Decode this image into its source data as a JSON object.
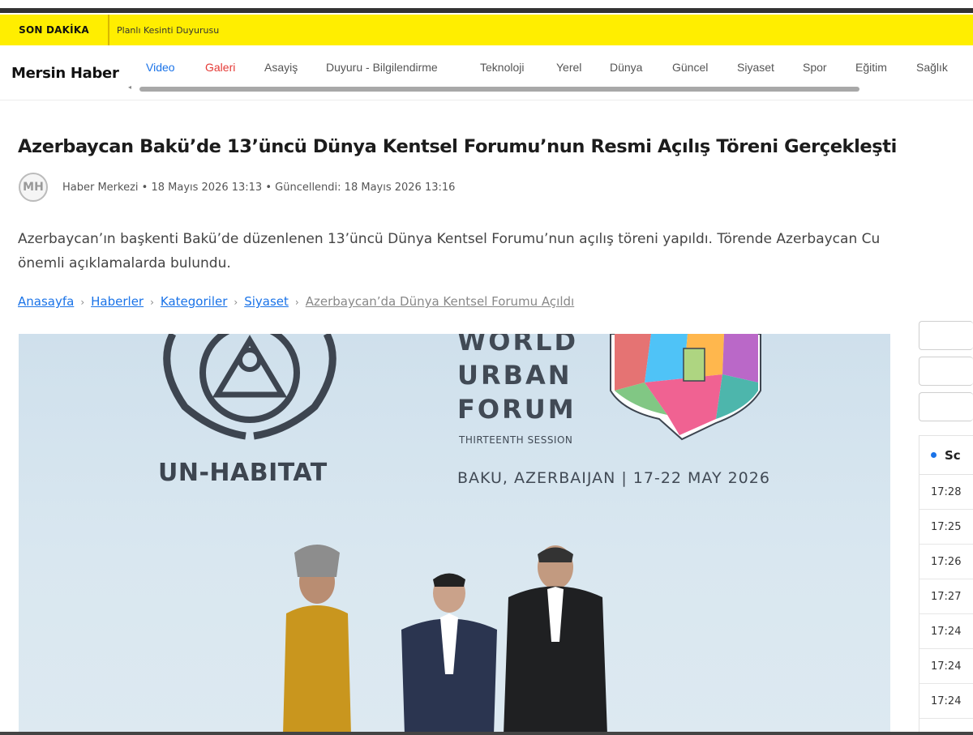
{
  "breaking": {
    "tag": "SON DAKİKA",
    "ticker": "Planlı Kesinti Duyurusu"
  },
  "brand": "Mersin Haber",
  "menu": [
    "Video",
    "Galeri",
    "Asayiş",
    "Duyuru - Bilgilendirme",
    "Teknoloji",
    "Yerel",
    "Dünya",
    "Güncel",
    "Siyaset",
    "Spor",
    "Eğitim",
    "Sağlık"
  ],
  "article": {
    "headline": "Azerbaycan Bakü’de 13’üncü Dünya Kentsel Forumu’nun Resmi Açılış Töreni Gerçekleşti",
    "avatar": "MH",
    "meta": "Haber Merkezi • 18 Mayıs 2026 13:13 • Güncellendi: 18 Mayıs 2026 13:16",
    "summary_line1": "Azerbaycan’ın başkenti Bakü’de düzenlenen 13’üncü Dünya Kentsel Forumu’nun açılış töreni yapıldı. Törende Azerbaycan Cu",
    "summary_line2": "önemli açıklamalarda bulundu."
  },
  "breadcrumb": [
    "Anasayfa",
    "Haberler",
    "Kategoriler",
    "Siyaset",
    "Azerbaycan’da Dünya Kentsel Forumu Açıldı"
  ],
  "hero": {
    "un_habitat": "UN-HABITAT",
    "wuf_line1": "WORLD",
    "wuf_line2": "URBAN",
    "wuf_line3": "FORUM",
    "session": "THIRTEENTH SESSION",
    "place": "BAKU, AZERBAIJAN | 17-22 MAY 2026"
  },
  "sidebar": {
    "heading": "Sc",
    "times": [
      "17:28",
      "17:25",
      "17:26",
      "17:27",
      "17:24",
      "17:24",
      "17:24"
    ]
  },
  "colors": {
    "breaking_bg": "#ffee00",
    "link": "#1a73e8",
    "galeri": "#e53935"
  }
}
